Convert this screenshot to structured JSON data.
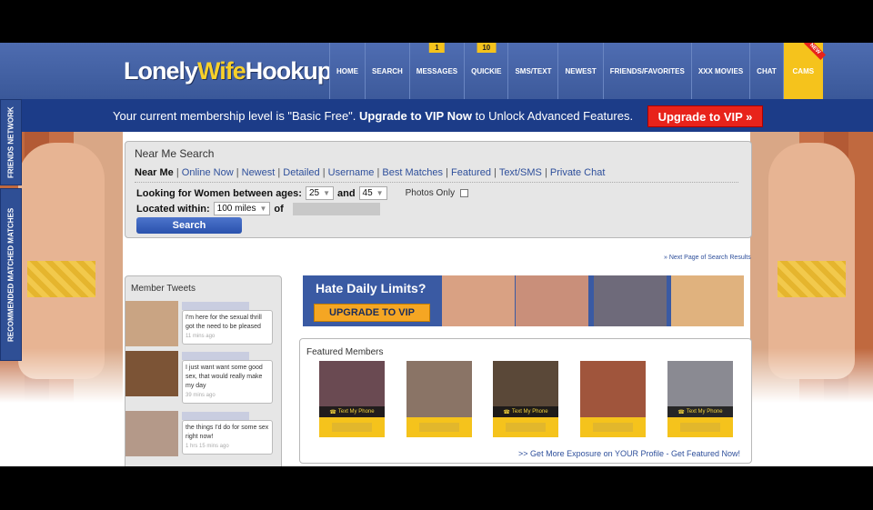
{
  "header": {
    "logo_part1": "Lonely",
    "logo_part2": "Wife",
    "logo_part3": "Hookup",
    "nav": [
      {
        "label": "HOME"
      },
      {
        "label": "SEARCH"
      },
      {
        "label": "MESSAGES",
        "badge": "1"
      },
      {
        "label": "QUICKIE",
        "badge": "10"
      },
      {
        "label": "SMS/TEXT"
      },
      {
        "label": "NEWEST"
      },
      {
        "label": "FRIENDS/FAVORITES"
      },
      {
        "label": "XXX MOVIES"
      },
      {
        "label": "CHAT"
      },
      {
        "label": "CAMS",
        "ribbon": "NEW"
      }
    ]
  },
  "banner": {
    "text_pre": "Your current membership level is \"Basic Free\". ",
    "text_bold": "Upgrade to VIP Now",
    "text_post": " to Unlock Advanced Features.",
    "button": "Upgrade to VIP »"
  },
  "side_tabs": {
    "tab1": "FRIENDS NETWORK",
    "tab2": "RECOMMENDED MATCHED MATCHES"
  },
  "search": {
    "title": "Near Me Search",
    "links": [
      "Near Me",
      "Online Now",
      "Newest",
      "Detailed",
      "Username",
      "Best Matches",
      "Featured",
      "Text/SMS",
      "Private Chat"
    ],
    "age_label": "Looking for Women between ages:",
    "age_min": "25",
    "and_label": "and",
    "age_max": "45",
    "photos_only": "Photos Only",
    "within_label": "Located within:",
    "within_value": "100 miles",
    "of_label": "of",
    "button": "Search"
  },
  "next_page": "» Next Page of Search Results",
  "tweets": {
    "title": "Member Tweets",
    "items": [
      {
        "text": "I'm here for the sexual thrill got the need to be pleased",
        "time": "11 mins ago"
      },
      {
        "text": "I just want want some good sex, that would really make my day",
        "time": "39 mins ago"
      },
      {
        "text": "the things I'd do for some sex right now!",
        "time": "1 hrs 15 mins ago"
      }
    ]
  },
  "promo": {
    "headline": "Hate Daily Limits?",
    "button": "UPGRADE TO VIP"
  },
  "featured": {
    "title": "Featured Members",
    "phone_label": "Text My Phone",
    "cta": ">> Get More Exposure on YOUR Profile - Get Featured Now!"
  },
  "colors": {
    "nav_blue": "#3a5899",
    "banner_blue": "#1c3c88",
    "accent_yellow": "#f5c31c",
    "cta_red": "#e8231b",
    "link_blue": "#2e4f9b"
  }
}
